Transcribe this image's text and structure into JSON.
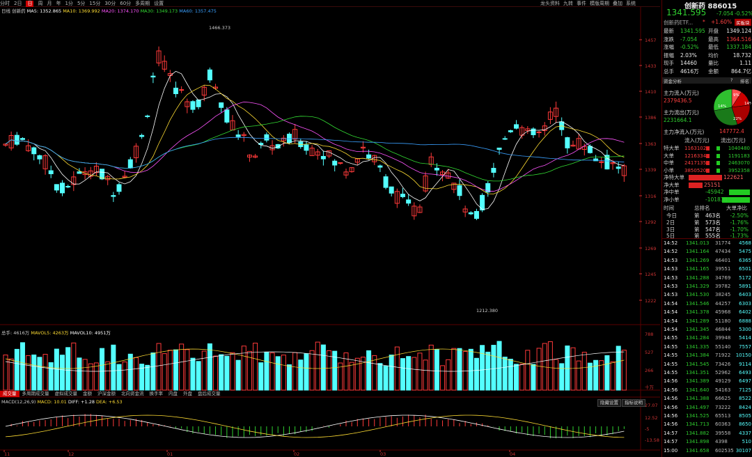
{
  "toolbar": {
    "left_items": [
      "分时",
      "2日",
      "日",
      "周",
      "月",
      "年",
      "1分",
      "5分",
      "15分",
      "30分",
      "60分",
      "多周期",
      "设置"
    ],
    "selected": "日",
    "right_items": [
      "龙头资料",
      "九转",
      "事件",
      "模版周期",
      "叠加",
      "系统"
    ]
  },
  "main_legend": {
    "period": "日线",
    "name": "创新药",
    "ma5": "MA5: 1352.865",
    "ma10": "MA10: 1369.992",
    "ma20": "MA20: 1374.170",
    "ma30": "MA30: 1349.173",
    "ma60": "MA60: 1357.475"
  },
  "colors": {
    "up": "#ff3a3a",
    "down": "#54ffff",
    "ma5": "#ffffff",
    "ma10": "#ffdd33",
    "ma20": "#ff55ff",
    "ma30": "#33dd33",
    "ma60": "#3aa0ff"
  },
  "chart_data": {
    "type": "candlestick",
    "y_ticks": [
      "1457",
      "1433",
      "1410",
      "1386",
      "1363",
      "1339",
      "1316",
      "1292",
      "1269",
      "1245",
      "1222"
    ],
    "x_ticks": [
      "11",
      "12",
      "01",
      "02",
      "03",
      "04"
    ],
    "high_label": "1466.373",
    "low_label": "1212.380",
    "volume": {
      "label": "总手: 4616万",
      "mavol5": "MAVOL5: 4263万",
      "mavol10": "MAVOL10: 4951万",
      "y_ticks": [
        "788",
        "527",
        "266",
        "十万"
      ]
    },
    "macd": {
      "label": "MACD(12,26,9)",
      "macd": "MACD: 10.01",
      "diff": "DIFF: +1.28",
      "dea": "DEA: +6.53",
      "y_ticks": [
        "27.07",
        "12.52",
        "-5",
        "-13.58"
      ]
    }
  },
  "bottom_tabs": [
    "成交量",
    "多周期成交量",
    "虚拟成交量",
    "金额",
    "沪深金额",
    "北向资金流",
    "换手率",
    "内盘",
    "外盘",
    "盘后成交量"
  ],
  "macd_buttons": [
    "隐藏设置",
    "指标说明"
  ],
  "right_panel": {
    "title": "创新药 886015",
    "price": "1341.595",
    "change": "-7.054",
    "change_pct": "-0.52%",
    "etf": "创新药ETF...",
    "etf_star": "*",
    "etf_pct": "+1.60%",
    "etf_btn": "买板块",
    "quote": [
      [
        "最新",
        "1341.595",
        "开盘",
        "1349.124"
      ],
      [
        "涨跌",
        "-7.054",
        "最高",
        "1364.516"
      ],
      [
        "涨幅",
        "-0.52%",
        "最低",
        "1337.184"
      ],
      [
        "振幅",
        "2.03%",
        "均价",
        "18.732"
      ],
      [
        "现手",
        "14460",
        "量比",
        "1.11"
      ],
      [
        "总手",
        "4616万",
        "金额",
        "864.7亿"
      ]
    ],
    "fund_tab": "资金分析",
    "fund_help": "?",
    "fund_more": "排名",
    "inflow_label": "主力流入(万元)",
    "inflow": "2379436.5",
    "outflow_label": "主力流出(万元)",
    "outflow": "2231664.1",
    "net_label": "主力净流入(万元)",
    "net": "147772.4",
    "pie_labels": [
      "9%",
      "14%",
      "14%",
      "22%"
    ],
    "flow_header": [
      "流入(万元)",
      "流出(万元)"
    ],
    "flow_rows": [
      [
        "特大单",
        "1163102",
        "1040480"
      ],
      [
        "大单",
        "1216334",
        "1191183"
      ],
      [
        "中单",
        "2417135",
        "2463070"
      ],
      [
        "小单",
        "3850520",
        "3952358"
      ]
    ],
    "net_rows": [
      [
        "净特大单",
        "122621"
      ],
      [
        "净大单",
        "25151"
      ],
      [
        "净中单",
        "-45942"
      ],
      [
        "净小单",
        "-101838"
      ]
    ],
    "rank_header": [
      "时间",
      "总排名",
      "大单净比"
    ],
    "rank_rows": [
      [
        "今日",
        "第",
        "463名",
        "-2.50%"
      ],
      [
        "2日",
        "第",
        "573名",
        "-1.76%"
      ],
      [
        "3日",
        "第",
        "547名",
        "-1.70%"
      ],
      [
        "5日",
        "第",
        "555名",
        "-1.73%"
      ]
    ],
    "ticks": [
      [
        "14:52",
        "1341.013",
        "31774",
        "4568"
      ],
      [
        "14:52",
        "1341.164",
        "47434",
        "5475"
      ],
      [
        "14:53",
        "1341.269",
        "46401",
        "6365"
      ],
      [
        "14:53",
        "1341.165",
        "39551",
        "6501"
      ],
      [
        "14:53",
        "1341.288",
        "34769",
        "5172"
      ],
      [
        "14:53",
        "1341.329",
        "39782",
        "5891"
      ],
      [
        "14:53",
        "1341.530",
        "38245",
        "6403"
      ],
      [
        "14:54",
        "1341.546",
        "44257",
        "6303"
      ],
      [
        "14:54",
        "1341.378",
        "45968",
        "6402"
      ],
      [
        "14:54",
        "1341.289",
        "51180",
        "6888"
      ],
      [
        "14:54",
        "1341.345",
        "46844",
        "5300"
      ],
      [
        "14:55",
        "1341.284",
        "39948",
        "5414"
      ],
      [
        "14:55",
        "1341.335",
        "55140",
        "7557"
      ],
      [
        "14:55",
        "1341.384",
        "71922",
        "10150"
      ],
      [
        "14:55",
        "1341.545",
        "73426",
        "9114"
      ],
      [
        "14:55",
        "1341.351",
        "52962",
        "6493"
      ],
      [
        "14:56",
        "1341.389",
        "49129",
        "6497"
      ],
      [
        "14:56",
        "1341.640",
        "54163",
        "7125"
      ],
      [
        "14:56",
        "1341.388",
        "66625",
        "8522"
      ],
      [
        "14:56",
        "1341.497",
        "73222",
        "8424"
      ],
      [
        "14:56",
        "1341.525",
        "65513",
        "8505"
      ],
      [
        "14:56",
        "1341.713",
        "60363",
        "8650"
      ],
      [
        "14:57",
        "1341.882",
        "39558",
        "4337"
      ],
      [
        "14:57",
        "1341.898",
        "4398",
        "510"
      ],
      [
        "15:00",
        "1341.658",
        "602535",
        "30107"
      ]
    ]
  }
}
